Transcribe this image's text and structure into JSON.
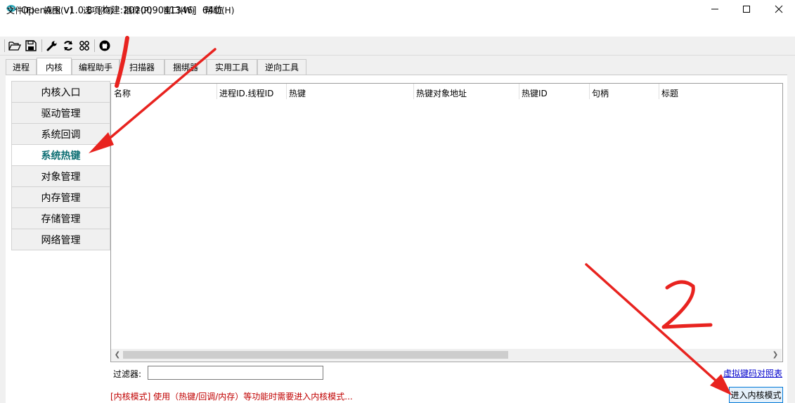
{
  "window": {
    "title": "OpenArk v1.0.8  [构建:202009041346]  64位",
    "min_glyph": "—",
    "max_glyph": "☐",
    "close_glyph": "✕"
  },
  "menu": [
    "文件(F)",
    "视图(V)",
    "选项(O)",
    "插件(P)",
    "窗口(W)",
    "帮助(H)"
  ],
  "toolbar": [
    "open-folder-icon",
    "save-icon",
    "wrench-icon",
    "refresh-icon",
    "grid-icon",
    "github-icon"
  ],
  "tabs": [
    "进程",
    "内核",
    "编程助手",
    "扫描器",
    "捆绑器",
    "实用工具",
    "逆向工具"
  ],
  "active_tab": "内核",
  "sidebar": {
    "items": [
      "内核入口",
      "驱动管理",
      "系统回调",
      "系统热键",
      "对象管理",
      "内存管理",
      "存储管理",
      "网络管理"
    ],
    "active": "系统热键"
  },
  "table": {
    "columns": [
      "名称",
      "进程ID.线程ID",
      "热键",
      "热键对象地址",
      "热键ID",
      "句柄",
      "标题"
    ],
    "rows": []
  },
  "filter": {
    "label": "过滤器:",
    "value": ""
  },
  "virtual_key_link": "虚拟键码对照表",
  "status_text": "[内核模式] 使用（热键/回调/内存）等功能时需要进入内核模式...",
  "enter_kernel_button": "进入内核模式",
  "annotations": {
    "mark1": "1",
    "mark2": "2",
    "color": "#e8231f"
  },
  "colors": {
    "active_sidebar_text": "#0d6e73",
    "status_text": "#c00000",
    "link": "#0000cc"
  }
}
